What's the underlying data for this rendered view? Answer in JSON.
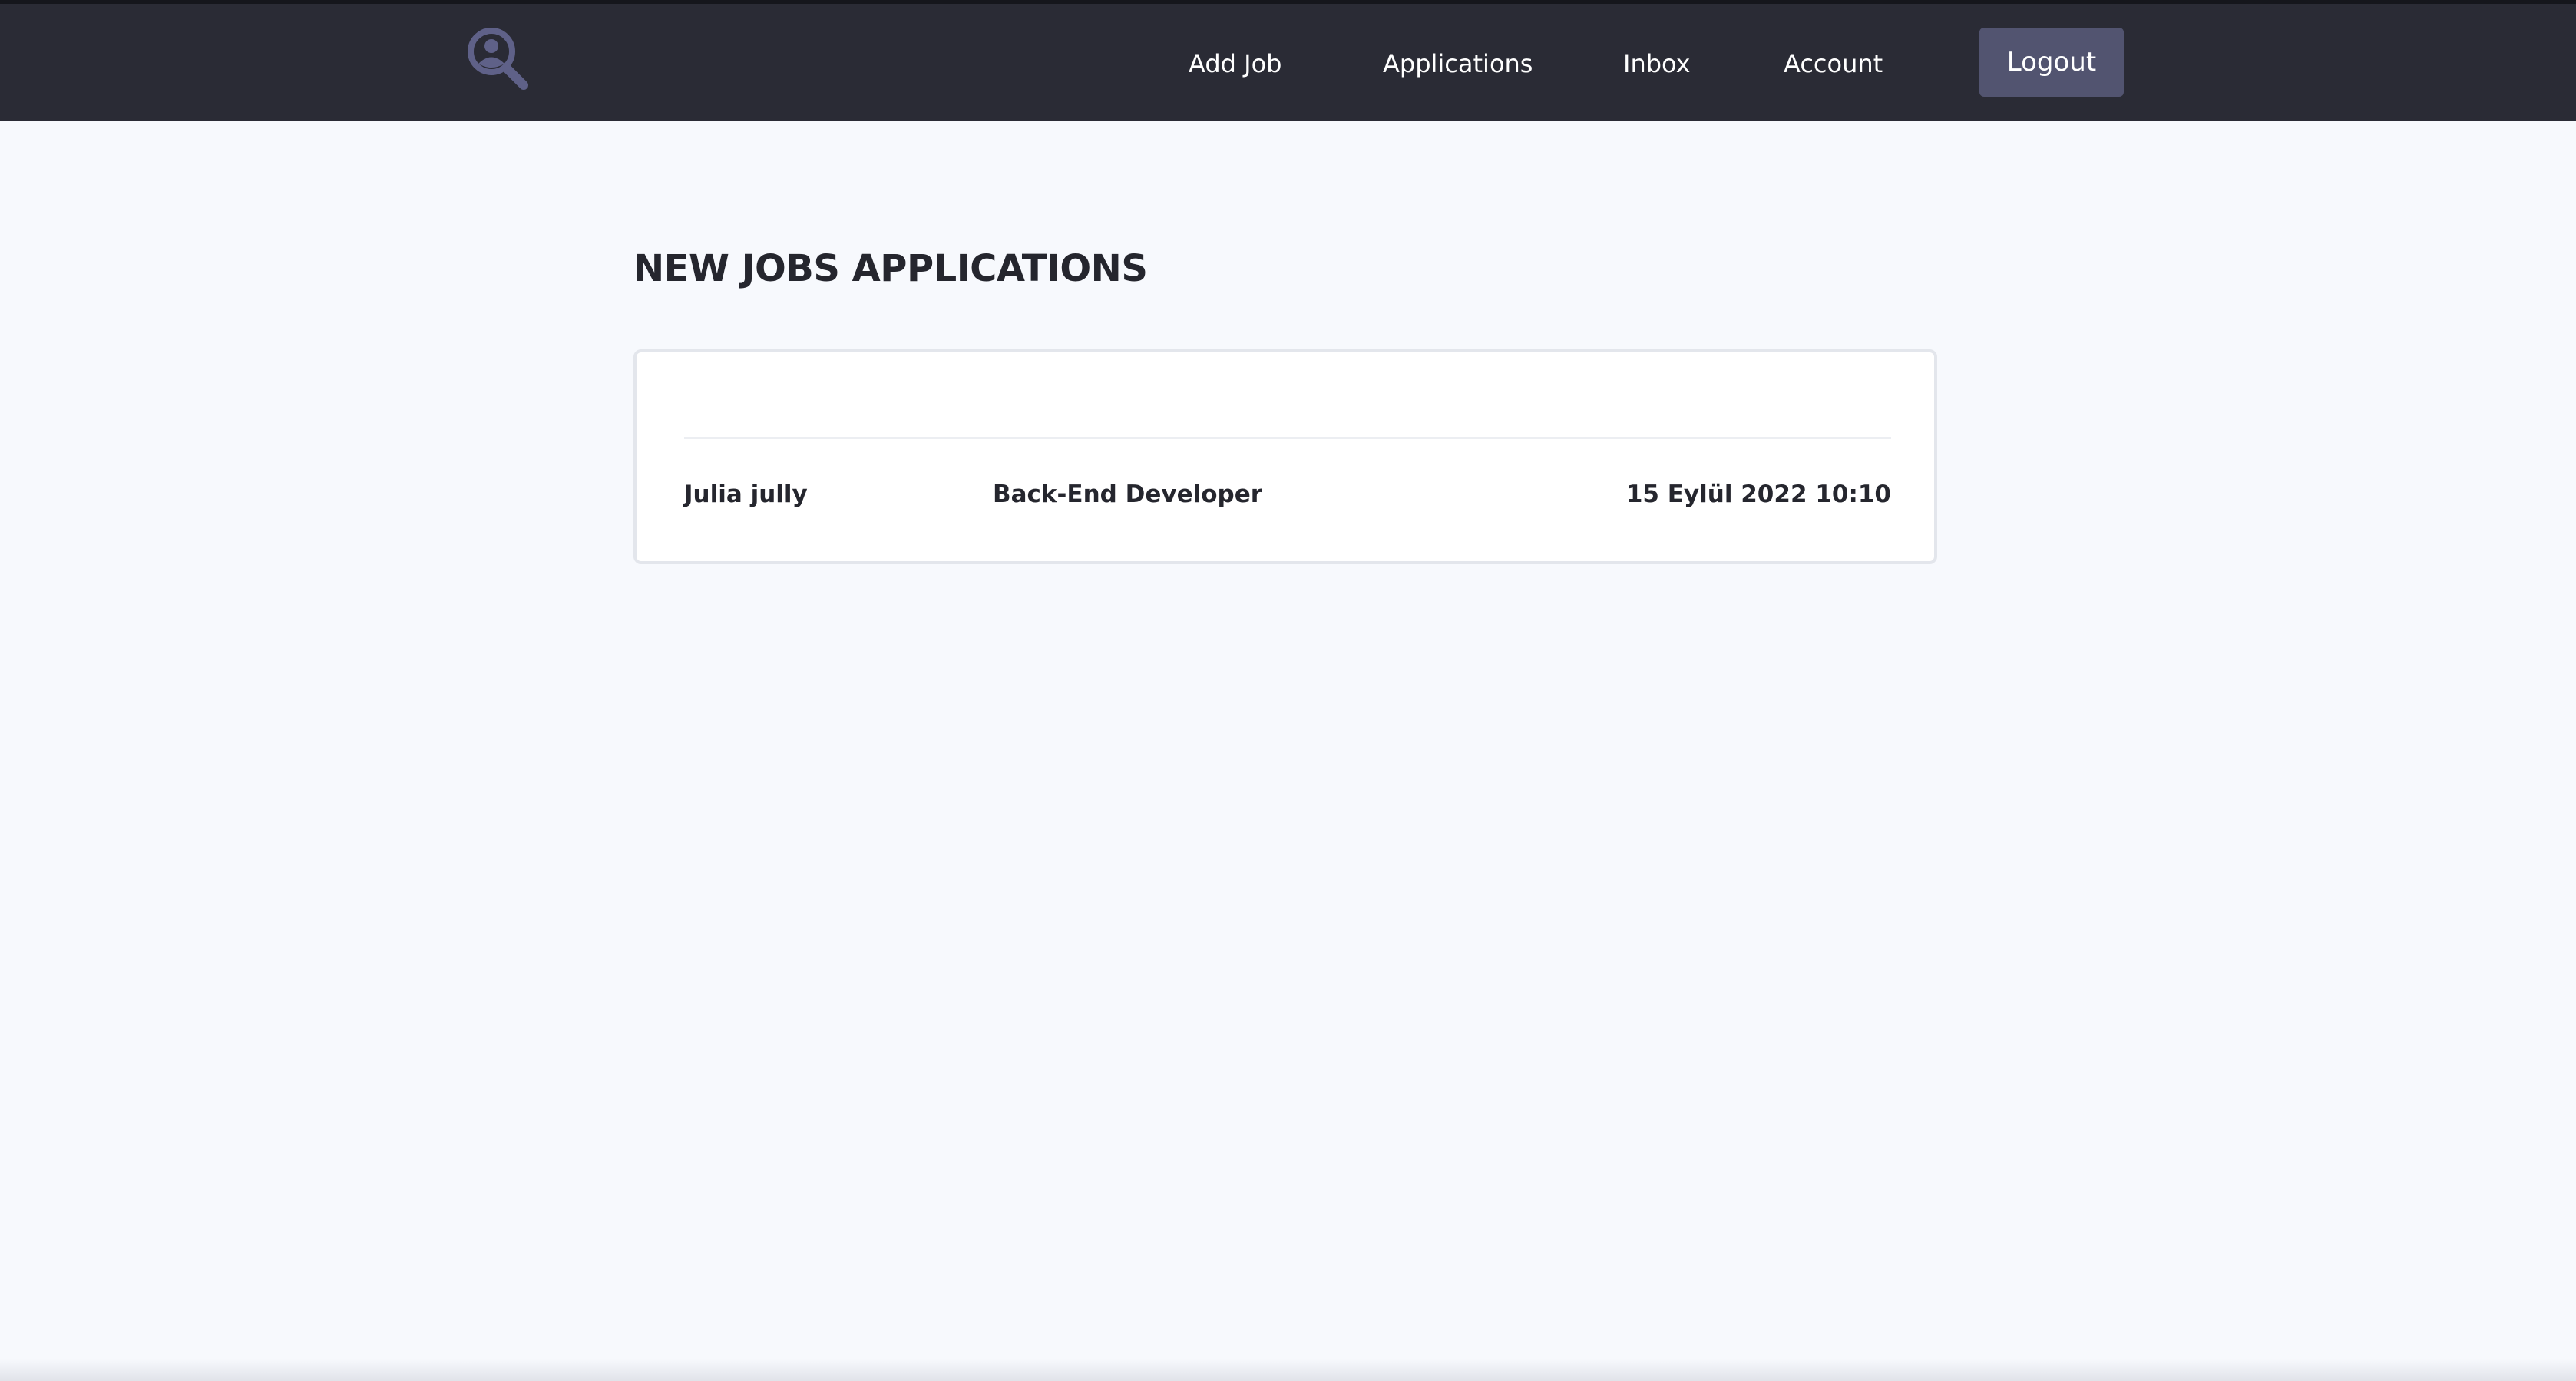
{
  "colors": {
    "navbar_bg": "#2a2b35",
    "page_bg": "#f7f9fd",
    "logout_bg": "#525470",
    "logo_color": "#5f6188",
    "text_dark": "#25262e"
  },
  "header": {
    "logo_icon": "search-user-icon",
    "nav": {
      "add_job": "Add Job",
      "applications": "Applications",
      "inbox": "Inbox",
      "account": "Account"
    },
    "logout_label": "Logout"
  },
  "main": {
    "title": "NEW JOBS APPLICATIONS",
    "applications": [
      {
        "applicant": "Julia jully",
        "position": "Back-End Developer",
        "date": "15 Eylül 2022 10:10"
      }
    ]
  }
}
